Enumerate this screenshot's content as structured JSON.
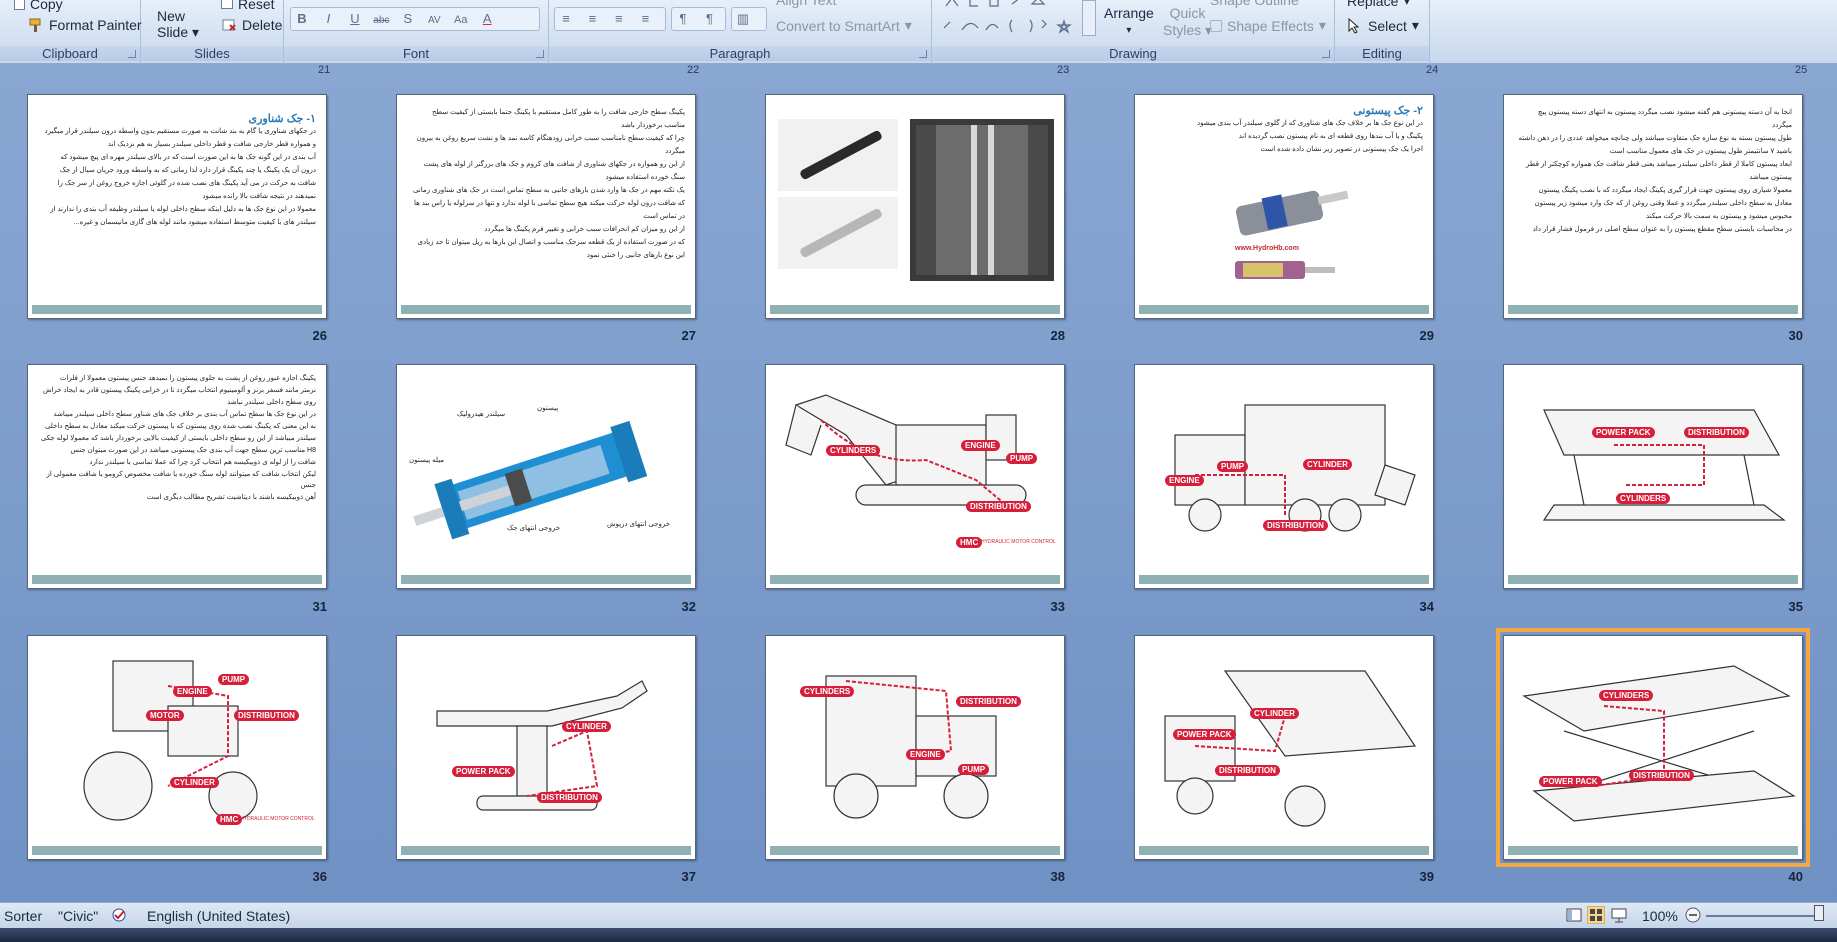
{
  "ribbon": {
    "clipboard": {
      "copy": "Copy",
      "format_painter": "Format Painter",
      "label": "Clipboard"
    },
    "slides": {
      "new_slide_line1": "New",
      "new_slide_line2": "Slide",
      "reset": "Reset",
      "delete": "Delete",
      "label": "Slides"
    },
    "font": {
      "label": "Font",
      "buttons": [
        "B",
        "I",
        "U",
        "abc",
        "S",
        "AV",
        "Aa",
        "A"
      ]
    },
    "paragraph": {
      "label": "Paragraph",
      "align_text": "Align Text",
      "convert_smartart": "Convert to SmartArt"
    },
    "drawing": {
      "label": "Drawing",
      "arrange": "Arrange",
      "quick_styles_line1": "Quick",
      "quick_styles_line2": "Styles",
      "shape_outline": "Shape Outline",
      "shape_effects": "Shape Effects"
    },
    "editing": {
      "label": "Editing",
      "replace": "Replace",
      "select": "Select"
    }
  },
  "top_numbers": [
    "21",
    "22",
    "23",
    "24",
    "25"
  ],
  "slides": [
    {
      "number": "26",
      "kind": "text",
      "heading": "۱- جک شناوری",
      "lines": [
        "در جکهای شناوری یا گام به بند شانت به صورت مستقیم بدون واسطه درون سیلندر قرار میگیرد",
        "و همواره قطر خارجی شافت و قطر داخلی سیلندر بسیار به هم نزدیک اند",
        "آب بندی در این گونه جک ها به این صورت است که در بالای سیلندر مهره ای پیچ میشود که",
        "درون آن یک پکینگ یا چند پکینگ قرار دارد لذا زمانی که به واسطه ورود جریان سیال از جک",
        "شافت به حرکت در می آید پکینگ های نصب شده در گلوئی اجازه خروج روغن از سر جک را",
        "نمیدهند در نتیجه شافت بالا رانده میشود",
        "معمولا در این نوع جک ها به دلیل اینکه سطح داخلی لوله یا سیلندر وظیفه آب بندی را ندارند از",
        "سیلندر های با کیفیت متوسط استفاده میشود مانند لوله های گازی مانیسمان و غیره..."
      ]
    },
    {
      "number": "27",
      "kind": "text",
      "heading": "",
      "lines": [
        "پکینگ سطح خارجی شافت را به طور کامل مستقیم با پکینگ حتما بایستی از کیفیت سطح",
        "مناسب برخوردار باشد",
        "چرا که کیفیت سطح نامناسب سبب خرابی زودهنگام کاسه نمد ها و نشت سریع روغن به بیرون",
        "میگردد",
        "از این رو همواره در جکهای شناوری از شافت های کروم و جک های بزرگتر از لوله های پشت",
        "سنگ خورده استفاده میشود",
        "یک نکته مهم در جک ها وارد شدن بارهای جانبی به سطح تماس است در جک های شناوری زمانی",
        "که شافت درون لوله حرکت میکند هیچ سطح تماسی با لوله ندارد و تنها در سرلوله یا راس بند ها",
        "در تماس است",
        "از این رو میزان کم انحرافات سبب خرابی و تغییر فرم پکینگ ها میگردد",
        "که در صورت استفاده از یک قطعه سرجک مناسب و اتصال این بارها به ریل میتوان تا حد زیادی",
        "این نوع بارهای جانبی را خنثی نمود"
      ]
    },
    {
      "number": "28",
      "kind": "photos",
      "heading": "",
      "lines": []
    },
    {
      "number": "29",
      "kind": "diagram-text",
      "heading": "۲- جک پیستونی",
      "lines": [
        "در این نوع جک ها بر خلاف جک های شناوری که از گلوی سیلندر آب بندی میشود",
        "پکینگ و یا آب بندها روی قطعه ای به نام پیستون نصب گردیده اند",
        "اجزا یک جک پیستونی در تصویر زیر نشان داده شده است"
      ],
      "caption": "www.HydroHb.com"
    },
    {
      "number": "30",
      "kind": "text",
      "heading": "",
      "lines": [
        "انجا به آن دسته پیستونی هم گفته میشود نصب میگردد پیستون به انتهای دسته پیستون پیچ",
        "میگردد",
        "طول پیستون بسته به نوع سازه جک متفاوت میباشد ولی چنانچه میخواهد عددی را در ذهن داشته",
        "باشید ۷ سانتیمتر طول پیستون در جک های معمول مناسب است",
        "ابعاد پیستون کاملا از قطر داخلی سیلندر میباشد یعنی قطر شافت جک همواره کوچکتر از قطر",
        "پیستون میباشد",
        "معمولا شیاری روی پیستون جهت قرار گیری پکینگ ایجاد میگردد که با نصب پکینگ پیستون",
        "معادل به سطح داخلی سیلندر میگردد و عملا وقتی روغن از که جک وارد میشود زیر پیستون",
        "محبوس میشود و پیستون به سمت بالا حرکت میکند",
        "در محاسبات بایستی سطح مقطع پیستون را به عنوان سطح اصلی در فرمول فشار قرار داد"
      ]
    },
    {
      "number": "31",
      "kind": "text",
      "heading": "",
      "lines": [
        "پکینگ اجازه عبور روغن از پشت به جلوی پیستون را نمیدهد جنس پیستون معمولا از فلزات",
        "نرمتر مانند فسفر برنز و آلومینیوم انتخاب میگردد تا در خرابی پکینگ پیستون قادر به ایجاد خراش",
        "روی سطح داخلی سیلندر نباشد",
        "در این نوع جک ها سطح تماس آب بندی بر خلاف جک های شناور سطح داخلی سیلندر میباشد",
        "به این معنی که پکینگ نصب شده روی پیستون که با پیستون حرکت میکند معادل به سطح داخلی",
        "سیلندر میباشد از این رو سطح داخلی بایستی از کیفیت بالایی برخوردار باشد که معمولا لوله جکی",
        "H8 مناسب ترین سطح جهت آب بندی جک پیستونی میباشد در این صورت میتوان جنس",
        "شافت را از لوله ی ذوبیکیسه هم انتخاب کرد چرا که عملا تماسی با سیلندر ندارد",
        "لیکن انتخاب شافت که میتوانند لوله سنگ خورده یا شافت مخصوص کرومو یا شافت معمولی از جنس",
        "آهن ذوبیکیسه باشند با دیتاشیت تشریح مطالب دیگری است"
      ]
    },
    {
      "number": "32",
      "kind": "cutaway",
      "labels": [
        "سیلندر هیدرولیک",
        "پیستون",
        "میله پیستون",
        "خروجی انتهای جک",
        "خروجی انتهای درپوش"
      ]
    },
    {
      "number": "33",
      "kind": "machine",
      "tags": [
        "CYLINDERS",
        "ENGINE",
        "PUMP",
        "DISTRIBUTION",
        "HMC"
      ],
      "footnote": "HYDRAULIC MOTOR CONTROL"
    },
    {
      "number": "34",
      "kind": "machine",
      "tags": [
        "ENGINE",
        "PUMP",
        "CYLINDER",
        "DISTRIBUTION"
      ]
    },
    {
      "number": "35",
      "kind": "machine",
      "tags": [
        "POWER PACK",
        "DISTRIBUTION",
        "CYLINDERS"
      ]
    },
    {
      "number": "36",
      "kind": "machine",
      "tags": [
        "ENGINE",
        "PUMP",
        "MOTOR",
        "DISTRIBUTION",
        "CYLINDER",
        "HMC"
      ],
      "footnote": "HYDRAULIC MOTOR CONTROL"
    },
    {
      "number": "37",
      "kind": "machine",
      "tags": [
        "CYLINDER",
        "POWER PACK",
        "DISTRIBUTION"
      ]
    },
    {
      "number": "38",
      "kind": "machine",
      "tags": [
        "CYLINDERS",
        "DISTRIBUTION",
        "ENGINE",
        "PUMP"
      ]
    },
    {
      "number": "39",
      "kind": "machine",
      "tags": [
        "CYLINDER",
        "POWER PACK",
        "DISTRIBUTION"
      ]
    },
    {
      "number": "40",
      "kind": "machine",
      "tags": [
        "CYLINDERS",
        "POWER PACK",
        "DISTRIBUTION"
      ],
      "selected": true
    }
  ],
  "status": {
    "view": "Sorter",
    "theme": "\"Civic\"",
    "language": "English (United States)",
    "zoom": "100%"
  },
  "colors": {
    "ribbon": "#d4e1f2",
    "sorter_bg": "#7d9ccb",
    "tag_red": "#d6203b",
    "selected": "#f3a642",
    "slide_footer": "#8fb1b3"
  }
}
